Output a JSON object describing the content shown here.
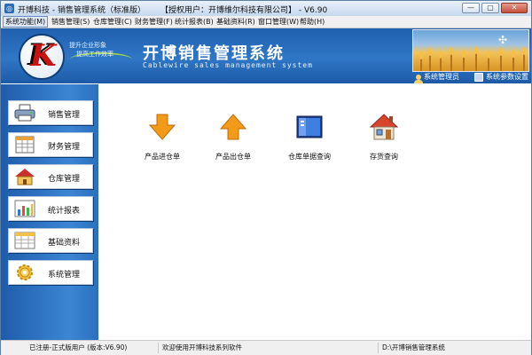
{
  "window": {
    "title": "开博科技 - 销售管理系统（标准版）",
    "license": "【授权用户：开博维尔科技有限公司】 - V6.90",
    "buttons": {
      "minimize": "—",
      "maximize": "▢",
      "close": "✕"
    }
  },
  "menu": [
    {
      "label": "系统功能(M)",
      "active": true
    },
    {
      "label": "销售管理(S)"
    },
    {
      "label": "仓库管理(C)"
    },
    {
      "label": "财务管理(F)"
    },
    {
      "label": "统计报表(B)"
    },
    {
      "label": "基础资料(R)"
    },
    {
      "label": "窗口管理(W)"
    },
    {
      "label": "帮助(H)"
    }
  ],
  "banner": {
    "logo_letter": "K",
    "slogan_line1": "提升企业形象",
    "slogan_line2": "提高工作效率",
    "title": "开博销售管理系统",
    "subtitle": "Cablewire sales management system",
    "user_label": "系统管理员",
    "settings_label": "系统参数设置"
  },
  "sidebar": [
    {
      "label": "销售管理",
      "icon": "printer-icon"
    },
    {
      "label": "财务管理",
      "icon": "ledger-icon"
    },
    {
      "label": "仓库管理",
      "icon": "house-icon"
    },
    {
      "label": "统计报表",
      "icon": "bar-chart-icon"
    },
    {
      "label": "基础资料",
      "icon": "table-icon"
    },
    {
      "label": "系统管理",
      "icon": "gear-icon"
    }
  ],
  "main": {
    "tiles": [
      {
        "label": "产品进仓单",
        "icon": "arrow-down-icon"
      },
      {
        "label": "产品出仓单",
        "icon": "arrow-up-icon"
      },
      {
        "label": "仓库单据查询",
        "icon": "window-icon"
      },
      {
        "label": "存货查询",
        "icon": "house-icon"
      }
    ]
  },
  "status": {
    "registration": "已注册-正式版用户 (版本:V6.90)",
    "welcome": "欢迎使用开博科技系列软件",
    "path": "D:\\开博销售管理系统"
  },
  "colors": {
    "banner": "#2f77c6",
    "sidebar": "#3b86d4",
    "accent_orange": "#f29a1a"
  }
}
